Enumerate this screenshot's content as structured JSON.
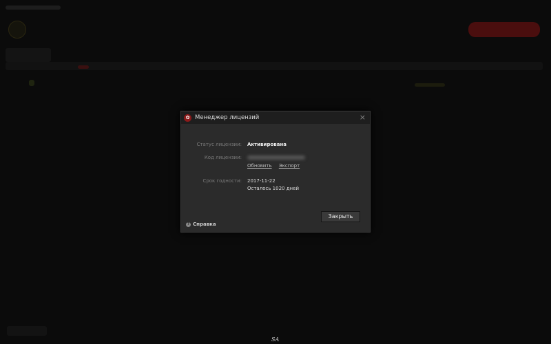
{
  "dialog": {
    "title": "Менеджер лицензий",
    "status_label": "Статус лицензии:",
    "status_value": "Активирована",
    "code_label": "Код лицензии:",
    "refresh_link": "Обновить",
    "export_link": "Экспорт",
    "expiry_label": "Срок годности:",
    "expiry_date": "2017-11-22",
    "days_left": "Осталось 1020 дней",
    "close_button": "Закрыть",
    "help_link": "Справка",
    "close_icon": "×"
  },
  "watermark": "SA",
  "colors": {
    "accent": "#8b1a1a",
    "primary_button_bg": "#5a1414"
  }
}
